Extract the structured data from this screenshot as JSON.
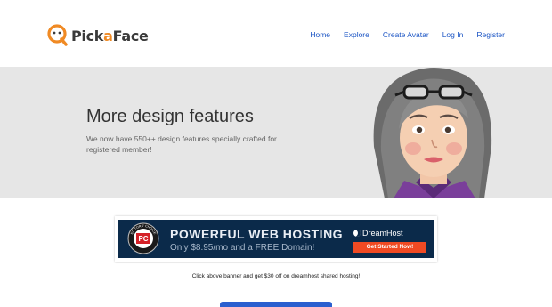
{
  "brand": {
    "name_part1": "Pick",
    "name_part2": "a",
    "name_part3": "Face",
    "accent": "#f08a24"
  },
  "nav": {
    "items": [
      "Home",
      "Explore",
      "Create Avatar",
      "Log In",
      "Register"
    ],
    "link_color": "#1a54c4"
  },
  "hero": {
    "title": "More design features",
    "subtitle": "We now have 550++ design features specially crafted for registered member!",
    "background": "#e6e6e6"
  },
  "ad": {
    "headline": "POWERFUL WEB HOSTING",
    "offer": "Only $8.95/mo and a FREE Domain!",
    "brand": "DreamHost",
    "cta": "Get Started Now!",
    "badge": "PC",
    "badge_ring": "EDITORS' CHOICE"
  },
  "caption": "Click above banner and get $30 off on dreamhost shared hosting!"
}
